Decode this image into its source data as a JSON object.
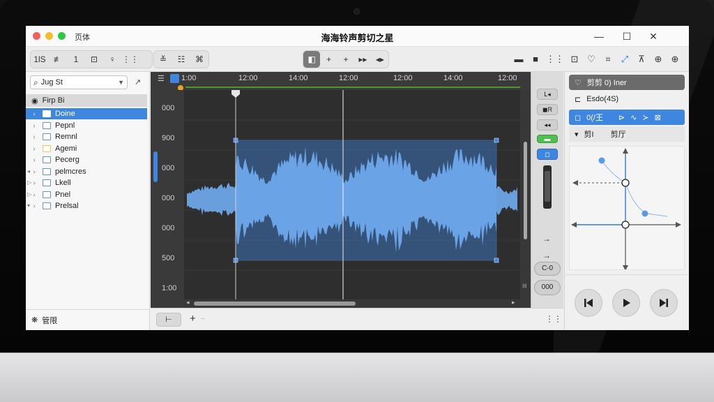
{
  "window": {
    "app_label": "页体",
    "title": "海海铃声剪切之星",
    "controls": {
      "minimize": "—",
      "maximize": "☐",
      "close": "✕"
    },
    "traffic_colors": [
      "#f4605a",
      "#f5bd2e",
      "#2bc840"
    ]
  },
  "toolbar": {
    "left_group": [
      "1lS",
      "≢",
      "1",
      "⊡",
      "♀",
      "⋮⋮"
    ],
    "edit_group": [
      "≚",
      "☷",
      "⌘"
    ],
    "center_group": [
      "◧",
      "+",
      "+",
      "▸▸",
      "◂▸"
    ],
    "right_icons": [
      "▬",
      "■",
      "⋮⋮"
    ],
    "panel_icons": [
      "⊡",
      "♡",
      "⌗",
      "⤢",
      "⊼",
      "⊕",
      "⊕"
    ]
  },
  "sidebar": {
    "search_value": "Jug St",
    "header": "Firp Bi",
    "header_icon": "◉",
    "collapse_icon": "↗",
    "items": [
      {
        "label": "Doine",
        "marker": "›",
        "selected": true,
        "color": "#3f86e0"
      },
      {
        "label": "Pepnl",
        "marker": "›",
        "selected": false,
        "color": "#6a8fc0"
      },
      {
        "label": "Remnl",
        "marker": "›",
        "selected": false,
        "color": "#6a8fc0"
      },
      {
        "label": "Agemi",
        "marker": "›",
        "selected": false,
        "color": "#e6c66a"
      },
      {
        "label": "Pecerg",
        "marker": "›",
        "selected": false,
        "color": "#6a8fc0"
      },
      {
        "label": "pelmcres",
        "marker": "›",
        "selected": false,
        "color": "#6a8fc0"
      },
      {
        "label": "Lkell",
        "marker": "›",
        "selected": false,
        "color": "#6a8fc0"
      },
      {
        "label": "Pnel",
        "marker": "›",
        "selected": false,
        "color": "#6a8fc0"
      },
      {
        "label": "Prelsal",
        "marker": "›",
        "selected": false,
        "color": "#6a8fc0"
      }
    ],
    "side_markers": [
      "◂",
      "▷",
      "▷",
      "▾"
    ],
    "footer_label": "管限",
    "footer_icon": "❋"
  },
  "editor": {
    "start_label": "1:00",
    "time_labels": [
      "12:00",
      "14:00",
      "12:00",
      "12:00",
      "14:00",
      "12:00"
    ],
    "amp_labels": [
      "000",
      "900",
      "000",
      "000",
      "000",
      "500",
      "1:00"
    ],
    "wave_color": "#6fa9ec",
    "selection_color": "#3f86e0"
  },
  "editor_footer": {
    "tool": "⊢",
    "add": "+",
    "more": "⋮⋮"
  },
  "strip": {
    "buttons": [
      "L◂",
      "◼R",
      "◂◂",
      "▬",
      "◻"
    ],
    "fader_labels": [
      "→",
      "→",
      "C-0",
      "000"
    ]
  },
  "rpanel": {
    "row1": {
      "icon": "♡",
      "label": "剪剪 0) Iner"
    },
    "row2": {
      "icon": "⊏",
      "label": "Esdo(4S)"
    },
    "row3": {
      "icon": "◻",
      "label": "0(/王",
      "tools": [
        "⊳",
        "∿",
        "≻",
        "⊠"
      ]
    },
    "row4": {
      "icon": "▾",
      "label": "剪I",
      "label2": "剪厅"
    }
  },
  "transport": {
    "prev": "previous",
    "play": "play",
    "next": "next"
  }
}
